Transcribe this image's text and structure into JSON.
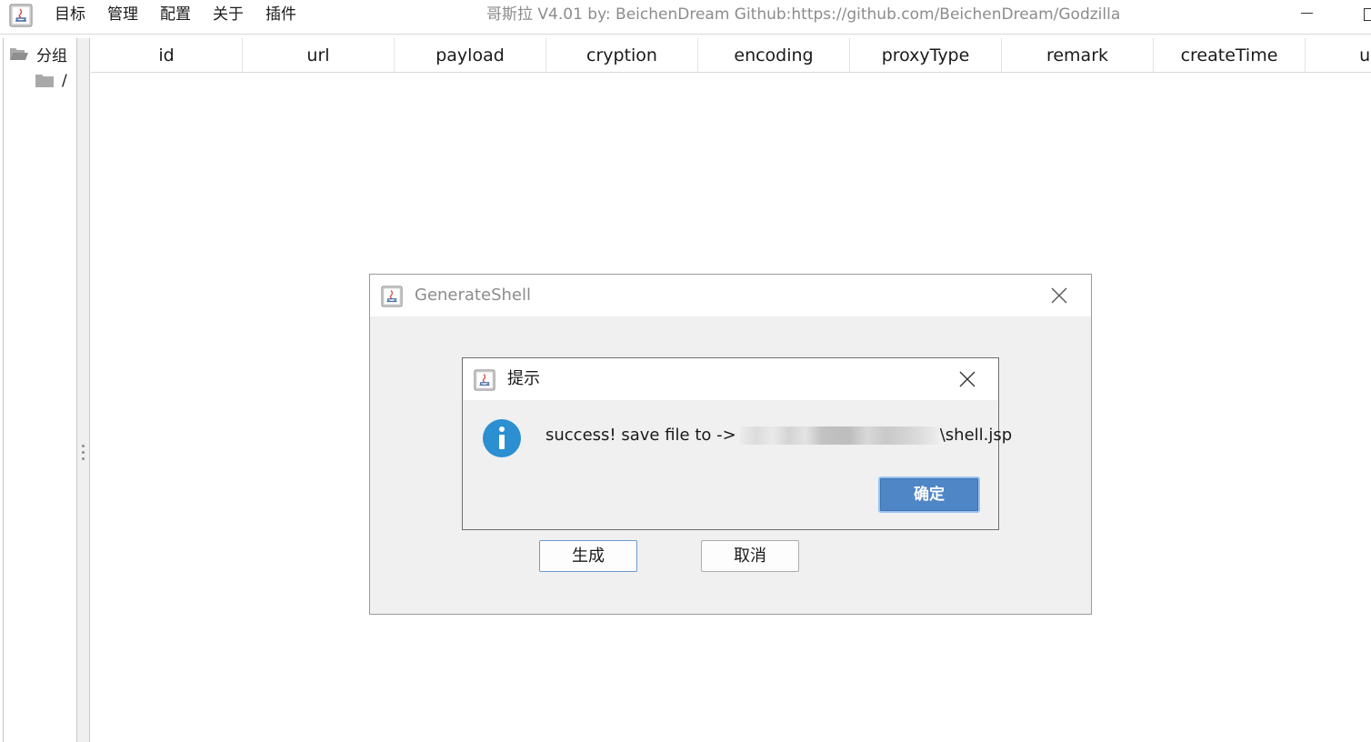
{
  "menu": {
    "items": [
      "目标",
      "管理",
      "配置",
      "关于",
      "插件"
    ]
  },
  "window": {
    "title": "哥斯拉   V4.01 by: BeichenDream Github:https://github.com/BeichenDream/Godzilla"
  },
  "sidebar": {
    "root_label": "分组",
    "child_label": "/"
  },
  "table": {
    "columns": [
      "id",
      "url",
      "payload",
      "cryption",
      "encoding",
      "proxyType",
      "remark",
      "createTime",
      "upda"
    ]
  },
  "generate_dialog": {
    "title": "GenerateShell",
    "generate_label": "生成",
    "cancel_label": "取消"
  },
  "message_dialog": {
    "title": "提示",
    "message_prefix": "success! save file to ->",
    "message_suffix": "\\shell.jsp",
    "ok_label": "确定"
  },
  "colors": {
    "info_icon": "#2b8fd1",
    "ok_button": "#4f86c6"
  },
  "icons": [
    "java-app-icon",
    "folder-open-icon",
    "folder-icon",
    "close-icon",
    "info-icon"
  ]
}
